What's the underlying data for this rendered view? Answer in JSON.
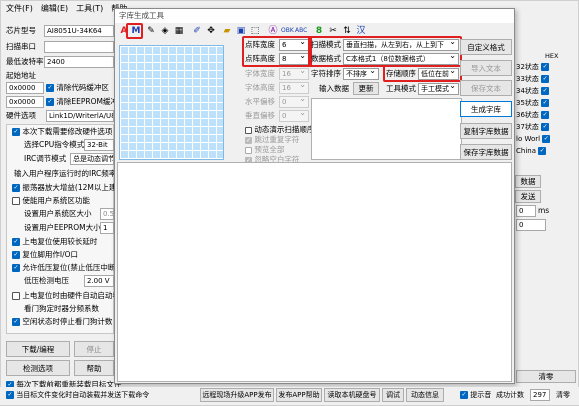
{
  "menu": [
    "文件(F)",
    "编辑(E)",
    "工具(T)",
    "帮助"
  ],
  "left": {
    "chip_label": "芯片型号",
    "chip_value": "AI8051U-34K64",
    "port_label": "扫描串口",
    "baud_label": "最低波特率",
    "baud_value": "2400",
    "start_label": "起始地址",
    "addr1": "0x0000",
    "clear_code": "清除代码缓冲区",
    "addr2": "0x0000",
    "clear_eeprom": "清除EEPROM缓冲区",
    "hw_label": "硬件选项",
    "hw_tabs": "Link1D/WriterlA/U8",
    "opt_set": "本次下载需要修改硬件选项",
    "cpu_label": "选择CPU指令模式",
    "cpu_value": "32-Bit",
    "irc_label": "IRC调节模式",
    "irc_value": "总是动态调节",
    "irc_freq": "输入用户程序运行时的IRC频率",
    "osc": "振荡器放大增益(12M以上建议选择)",
    "sys_func": "使能用户系统区功能",
    "sys_size": "设置用户系统区大小",
    "sys_size_val": "0.5",
    "eeprom_size": "设置用户EEPROM大小",
    "eeprom_val": "1",
    "power_rst": "上电复位使用较长延时",
    "rst_io": "复位脚用作I/O口",
    "low_rst": "允许低压复位(禁止低压中断)",
    "low_volt_lbl": "低压检测电压",
    "low_volt_val": "2.00 V",
    "power_wdt": "上电复位时由硬件自动启动看门狗",
    "wdt_div": "看门狗定时器分频系数",
    "idle_wdt": "空闲状态时停止看门狗计数",
    "download_btn": "下载/编程",
    "stop_btn": "停止",
    "check_btn": "检测选项",
    "help_btn": "帮助",
    "reload": "每次下载前都重新装载目标文件",
    "auto": "当目标文件变化时自动装载并发送下载命令"
  },
  "right": {
    "hex_label": "HEX",
    "items": [
      "32状态",
      "33状态",
      "34状态",
      "35状态",
      "36状态",
      "37状态",
      "lo Worl",
      "China"
    ],
    "data_btn": "数据",
    "send_btn": "发送",
    "zero": "0",
    "ms": "ms",
    "tx": "0",
    "clear_btn": "清零"
  },
  "dialog": {
    "title": "字库生成工具",
    "m_label": "M",
    "a_label": "A",
    "toolbar_zh": "汉",
    "width_label": "点阵宽度",
    "width_val": "6",
    "height_label": "点阵高度",
    "height_val": "8",
    "font_w_label": "字体宽度",
    "font_w_val": "16",
    "font_h_label": "字体高度",
    "font_h_val": "16",
    "h_off_label": "水平偏移",
    "h_off_val": "0",
    "v_off_label": "垂直偏移",
    "v_off_val": "0",
    "scan_label": "扫描模式",
    "scan_val": "垂直扫描，从左到右，从上到下",
    "format_label": "数据格式",
    "format_val": "C本格式1（8位数据格式）",
    "order_label": "字符排序",
    "order_val": "不排序",
    "store_label": "存储顺序",
    "store_val": "低位在前",
    "input_label": "输入数据",
    "update_btn": "更新",
    "toolmodel_label": "工具模式",
    "toolmodel_val": "手工模式",
    "custom_btn": "自定义格式",
    "import_btn": "导入文本",
    "save_text_btn": "保存文本",
    "gen_btn": "生成字库",
    "copy_btn": "复制字库数据",
    "save_lib_btn": "保存字库数据",
    "cb_auto": "动态演示扫描顺序",
    "cb_skip": "跳过重复字符",
    "cb_preview": "预览全部",
    "cb_ignore": "忽略空白字符"
  },
  "status": {
    "s1": "远程现场升级APP发布",
    "s2": "发布APP帮助",
    "s3": "读取本机硬盘号",
    "s4": "调试",
    "s5": "动态信息",
    "s6": "提示音",
    "s7": "成功计数",
    "count": "297",
    "clear": "清零"
  },
  "colors": {
    "accent": "#0067c0",
    "red_box": "#e02020"
  }
}
